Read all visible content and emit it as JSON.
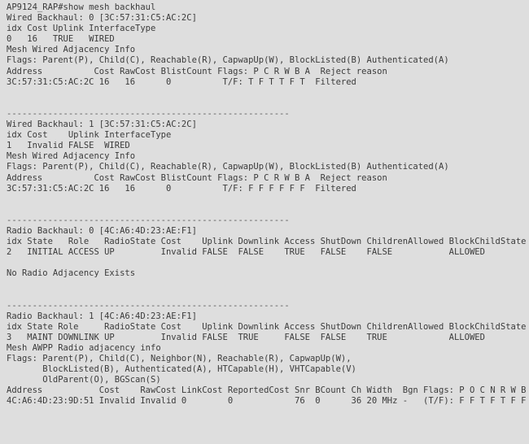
{
  "terminal": {
    "prompt": "AP9124_RAP#",
    "command": "show mesh backhaul",
    "background_color": "#dedede",
    "text_color": "#3b3b3b",
    "separator": "-------------------------------------------------------",
    "lines": [
      "AP9124_RAP#show mesh backhaul",
      "Wired Backhaul: 0 [3C:57:31:C5:AC:2C]",
      "idx Cost Uplink InterfaceType",
      "0   16   TRUE   WIRED",
      "Mesh Wired Adjacency Info",
      "Flags: Parent(P), Child(C), Reachable(R), CapwapUp(W), BlockListed(B) Authenticated(A)",
      "Address          Cost RawCost BlistCount Flags: P C R W B A  Reject reason",
      "3C:57:31:C5:AC:2C 16   16      0          T/F: T F T T F T  Filtered",
      "",
      "",
      "-------------------------------------------------------",
      "Wired Backhaul: 1 [3C:57:31:C5:AC:2C]",
      "idx Cost    Uplink InterfaceType",
      "1   Invalid FALSE  WIRED",
      "Mesh Wired Adjacency Info",
      "Flags: Parent(P), Child(C), Reachable(R), CapwapUp(W), BlockListed(B) Authenticated(A)",
      "Address          Cost RawCost BlistCount Flags: P C R W B A  Reject reason",
      "3C:57:31:C5:AC:2C 16   16      0          T/F: F F F F F F  Filtered",
      "",
      "",
      "-------------------------------------------------------",
      "Radio Backhaul: 0 [4C:A6:4D:23:AE:F1]",
      "idx State   Role   RadioState Cost    Uplink Downlink Access ShutDown ChildrenAllowed BlockChildState InterfaceType",
      "2   INITIAL ACCESS UP         Invalid FALSE  FALSE    TRUE   FALSE    FALSE           ALLOWED         RADIO",
      "",
      "No Radio Adjacency Exists",
      "",
      "",
      "-------------------------------------------------------",
      "Radio Backhaul: 1 [4C:A6:4D:23:AE:F1]",
      "idx State Role     RadioState Cost    Uplink Downlink Access ShutDown ChildrenAllowed BlockChildState InterfaceType",
      "3   MAINT DOWNLINK UP         Invalid FALSE  TRUE     FALSE  FALSE    TRUE            ALLOWED         RADIO",
      "Mesh AWPP Radio adjacency info",
      "Flags: Parent(P), Child(C), Neighbor(N), Reachable(R), CapwapUp(W),",
      "       BlockListed(B), Authenticated(A), HTCapable(H), VHTCapable(V)",
      "       OldParent(O), BGScan(S)",
      "Address           Cost    RawCost LinkCost ReportedCost Snr BCount Ch Width  Bgn Flags: P O C N R W B A H V S Reject reason",
      "4C:A6:4D:23:9D:51 Invalid Invalid 0        0            76  0      36 20 MHz -   (T/F): F F T F T F F T T T F -"
    ]
  }
}
